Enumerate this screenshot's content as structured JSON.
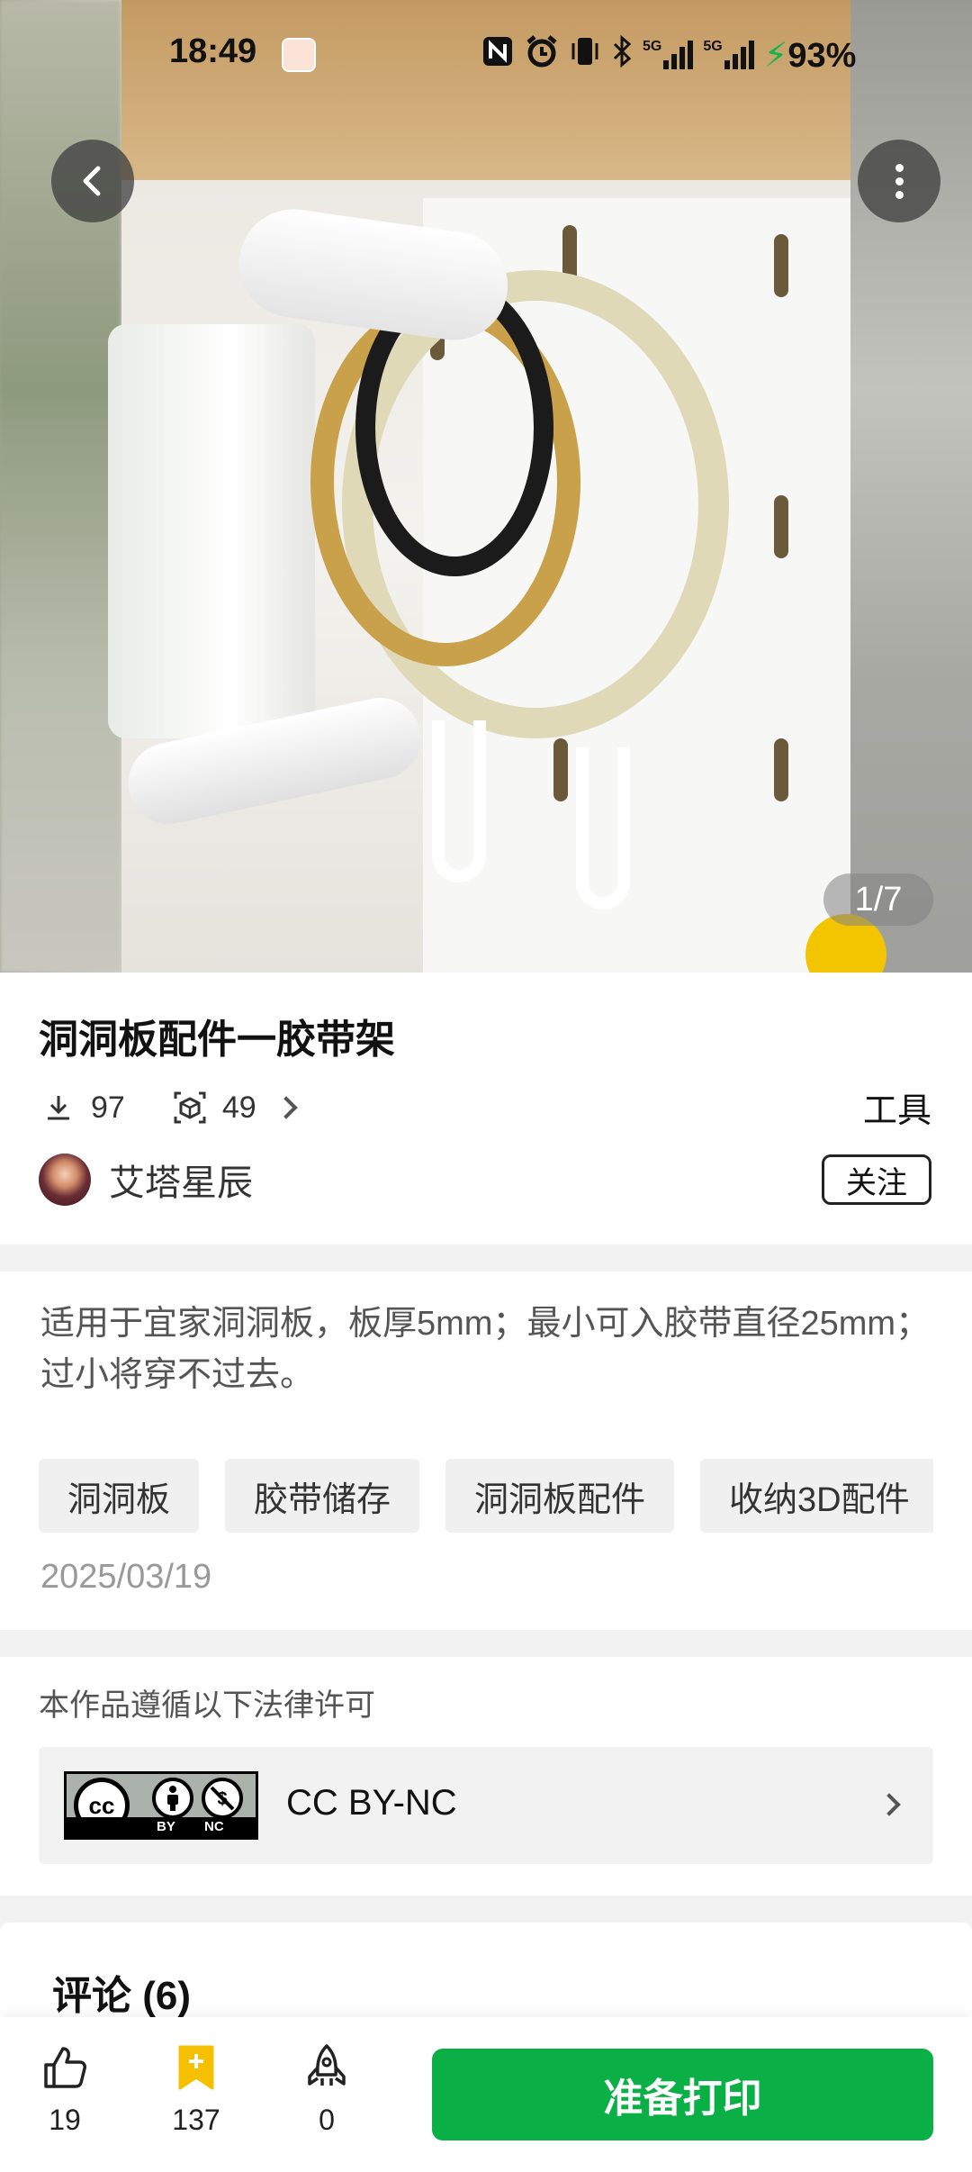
{
  "status_bar": {
    "time": "18:49",
    "signal_1": "5G",
    "signal_2": "5G",
    "battery": "93%"
  },
  "gallery": {
    "counter": "1/7"
  },
  "model": {
    "title": "洞洞板配件一胶带架",
    "downloads": "97",
    "prints": "49",
    "category": "工具",
    "author": "艾塔星辰",
    "follow_label": "关注"
  },
  "details": {
    "description": "适用于宜家洞洞板，板厚5mm；最小可入胶带直径25mm；过小将穿不过去。",
    "tags": [
      "洞洞板",
      "胶带储存",
      "洞洞板配件",
      "收纳3D配件"
    ],
    "date": "2025/03/19"
  },
  "license": {
    "heading": "本作品遵循以下法律许可",
    "name": "CC BY-NC",
    "badge_by": "BY",
    "badge_nc": "NC"
  },
  "comments": {
    "title": "评论 (6)"
  },
  "bottom_bar": {
    "likes": "19",
    "favorites": "137",
    "boosts": "0",
    "print_label": "准备打印"
  },
  "colors": {
    "accent_green": "#0aaf46",
    "favorite_yellow": "#f5c000"
  }
}
